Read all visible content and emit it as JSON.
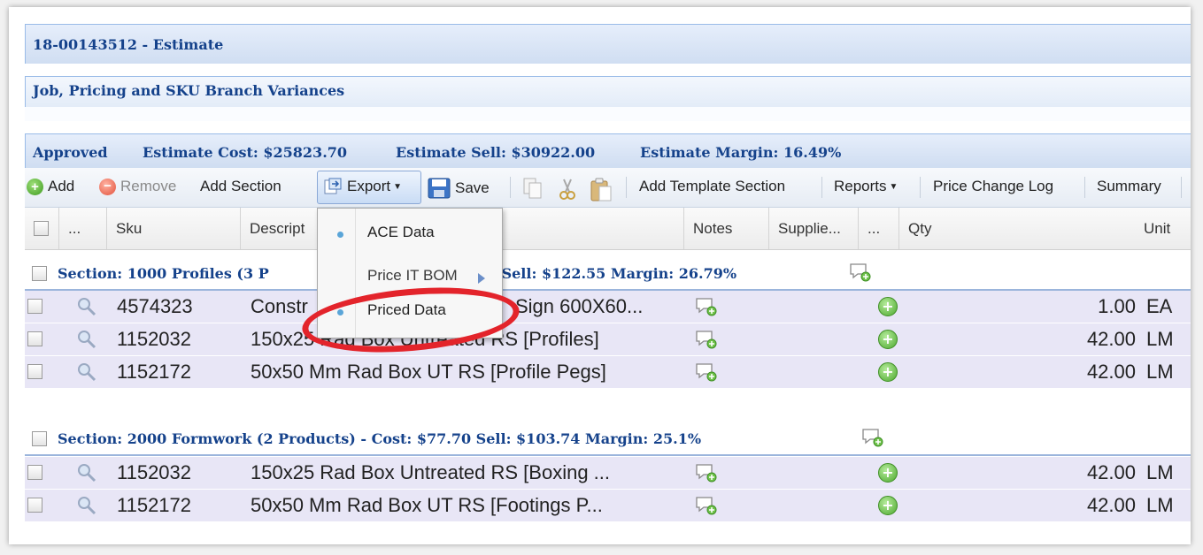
{
  "header": {
    "title": "18-00143512 - Estimate",
    "subtitle": "Job, Pricing and SKU Branch Variances",
    "status": {
      "state": "Approved",
      "cost": "Estimate Cost: $25823.70",
      "sell": "Estimate Sell: $30922.00",
      "margin": "Estimate Margin: 16.49%"
    }
  },
  "toolbar": {
    "add": "Add",
    "remove": "Remove",
    "add_section": "Add Section",
    "export": "Export",
    "save": "Save",
    "add_template_section": "Add Template Section",
    "reports": "Reports",
    "price_change_log": "Price Change Log",
    "summary": "Summary"
  },
  "columns": {
    "more1": "...",
    "sku": "Sku",
    "description": "Descript",
    "notes": "Notes",
    "supplier": "Supplie...",
    "more2": "...",
    "qty": "Qty",
    "unit": "Unit"
  },
  "export_menu": {
    "items": [
      "ACE Data",
      "Price IT BOM",
      "Priced Data"
    ]
  },
  "sections": [
    {
      "label_start": "Section: 1000 Profiles (3 P",
      "label_end": "72   Sell: $122.55   Margin: 26.79%",
      "rows": [
        {
          "sku": "4574323",
          "desc_start": "Constr",
          "desc_end": "Sign 600X60...",
          "qty": "1.00",
          "unit": "EA"
        },
        {
          "sku": "1152032",
          "desc": "150x25 Rad Box Untreated RS [Profiles]",
          "qty": "42.00",
          "unit": "LM"
        },
        {
          "sku": "1152172",
          "desc": "50x50 Mm Rad Box UT RS [Profile Pegs]",
          "qty": "42.00",
          "unit": "LM"
        }
      ]
    },
    {
      "label": "Section: 2000 Formwork (2 Products)  -  Cost: $77.70   Sell: $103.74   Margin: 25.1%",
      "rows": [
        {
          "sku": "1152032",
          "desc": "150x25 Rad Box Untreated RS [Boxing ...",
          "qty": "42.00",
          "unit": "LM"
        },
        {
          "sku": "1152172",
          "desc": "50x50 Mm Rad Box UT RS [Footings P...",
          "qty": "42.00",
          "unit": "LM"
        }
      ]
    }
  ],
  "icons": {
    "add": "add-circle-icon",
    "remove": "remove-circle-icon",
    "export": "export-icon",
    "save": "floppy-disk-icon",
    "copy": "copy-icon",
    "cut": "scissors-icon",
    "paste": "paste-icon",
    "search": "magnifier-icon",
    "note": "add-note-icon",
    "plus": "plus-circle-icon"
  },
  "colors": {
    "header_text": "#15428b",
    "row_background": "#e8e6f6",
    "annotation_circle": "#e3242b",
    "menu_dot": "#5aa5d8"
  }
}
